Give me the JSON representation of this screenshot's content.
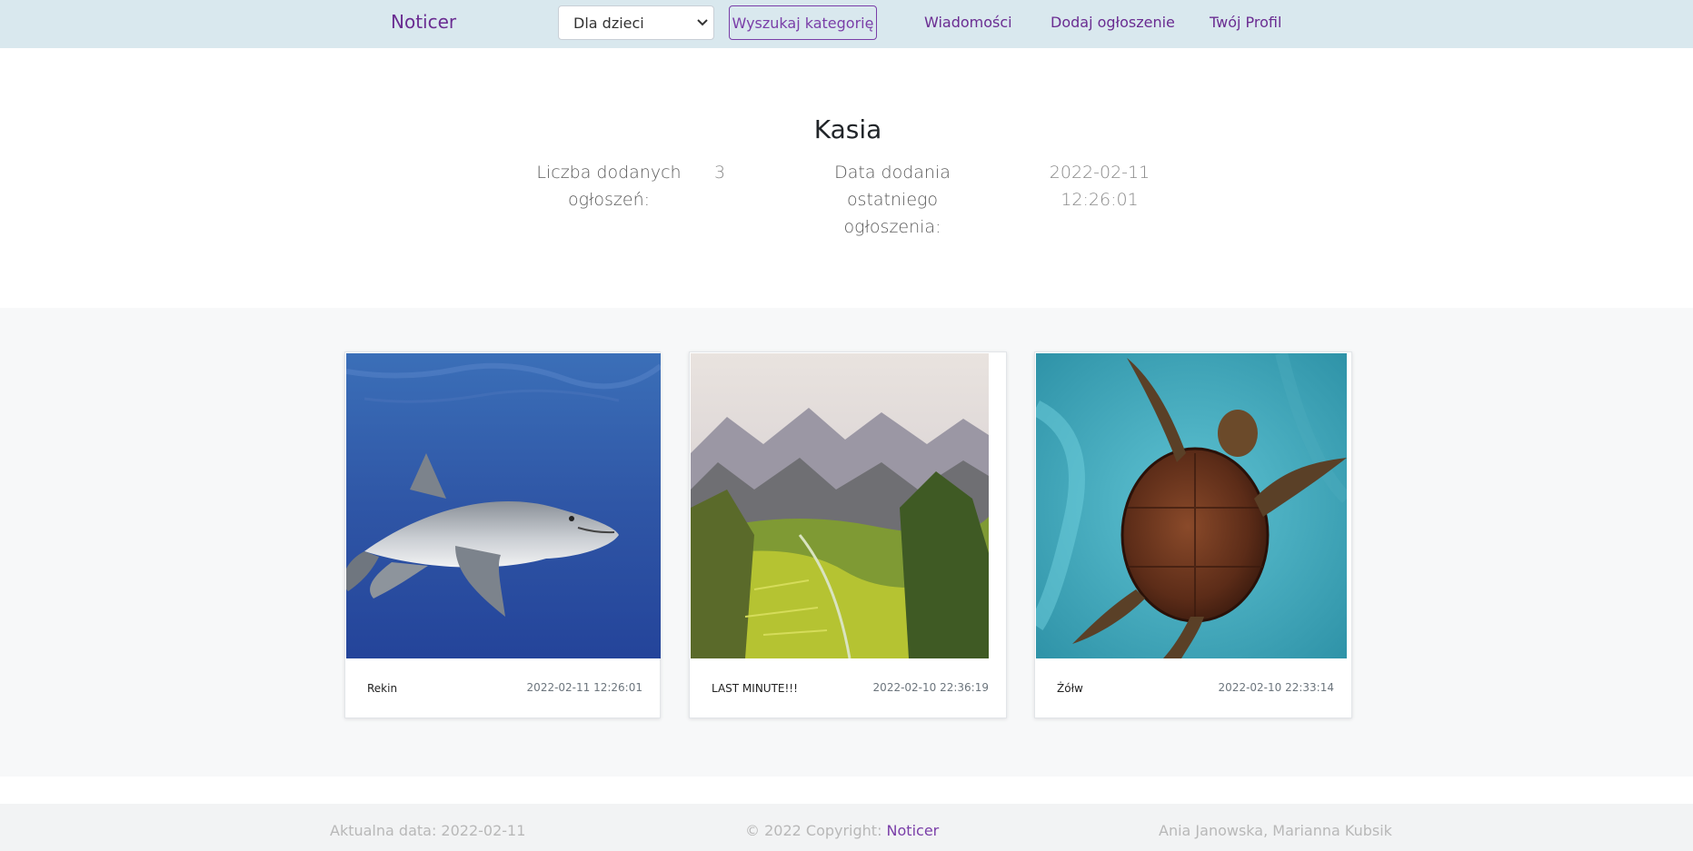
{
  "navbar": {
    "brand": "Noticer",
    "category_select": {
      "selected": "Dla dzieci"
    },
    "search_button": "Wyszukaj kategorię",
    "links": [
      "Wiadomości",
      "Dodaj ogłoszenie",
      "Twój Profil"
    ]
  },
  "profile": {
    "name": "Kasia",
    "stats": [
      {
        "label_line1": "Liczba dodanych",
        "label_line2": "ogłoszeń:",
        "value_line1": "3",
        "value_line2": ""
      },
      {
        "label_line1": "Data dodania ostatniego",
        "label_line2": "ogłoszenia:",
        "value_line1": "2022-02-11",
        "value_line2": "12:26:01"
      }
    ]
  },
  "listings": [
    {
      "title": "Rekin",
      "date": "2022-02-11 12:26:01",
      "image": "shark-photo"
    },
    {
      "title": "LAST MINUTE!!!",
      "date": "2022-02-10 22:36:19",
      "image": "mountain-valley-photo"
    },
    {
      "title": "Żółw",
      "date": "2022-02-10 22:33:14",
      "image": "sea-turtle-photo"
    }
  ],
  "footer": {
    "current_date_label": "Aktualna data: 2022-02-11",
    "copyright_prefix": "© 2022 Copyright: ",
    "copyright_link": "Noticer",
    "authors": "Ania Janowska, Marianna Kubsik"
  },
  "colors": {
    "navbar_bg": "#d9e8ee",
    "accent": "#6a2c91",
    "gallery_bg": "#f7f8f9"
  }
}
